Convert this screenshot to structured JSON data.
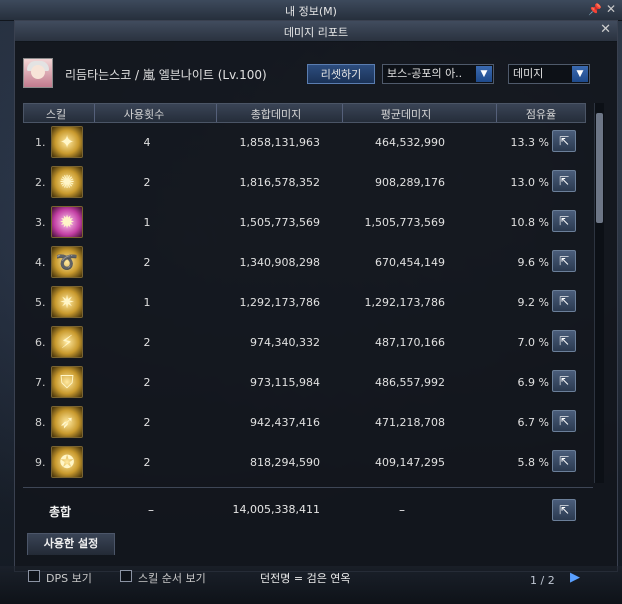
{
  "topbar": {
    "title": "내 정보(M)"
  },
  "window": {
    "title": "데미지 리포트"
  },
  "header": {
    "player": "리듬타는스코 / 嵐 엘븐나이트 (Lv.100)",
    "reset_label": "리셋하기",
    "dungeon_select": "보스-공포의 아..",
    "metric_select": "데미지"
  },
  "table": {
    "columns": [
      "스킬",
      "사용횟수",
      "총합데미지",
      "평균데미지",
      "점유율"
    ],
    "rows": [
      {
        "rank": "1.",
        "icon": "golden-whirl-skill-icon",
        "count": "4",
        "total": "1,858,131,963",
        "avg": "464,532,990",
        "share": "13.3 %"
      },
      {
        "rank": "2.",
        "icon": "golden-spin-skill-icon",
        "count": "2",
        "total": "1,816,578,352",
        "avg": "908,289,176",
        "share": "13.0 %"
      },
      {
        "rank": "3.",
        "icon": "pink-burst-skill-icon",
        "count": "1",
        "total": "1,505,773,569",
        "avg": "1,505,773,569",
        "share": "10.8 %"
      },
      {
        "rank": "4.",
        "icon": "golden-wave-skill-icon",
        "count": "2",
        "total": "1,340,908,298",
        "avg": "670,454,149",
        "share": "9.6 %"
      },
      {
        "rank": "5.",
        "icon": "golden-flame-skill-icon",
        "count": "1",
        "total": "1,292,173,786",
        "avg": "1,292,173,786",
        "share": "9.2 %"
      },
      {
        "rank": "6.",
        "icon": "golden-slash-skill-icon",
        "count": "2",
        "total": "974,340,332",
        "avg": "487,170,166",
        "share": "7.0 %"
      },
      {
        "rank": "7.",
        "icon": "golden-shield-skill-icon",
        "count": "2",
        "total": "973,115,984",
        "avg": "486,557,992",
        "share": "6.9 %"
      },
      {
        "rank": "8.",
        "icon": "golden-spear-skill-icon",
        "count": "2",
        "total": "942,437,416",
        "avg": "471,218,708",
        "share": "6.7 %"
      },
      {
        "rank": "9.",
        "icon": "golden-star-skill-icon",
        "count": "2",
        "total": "818,294,590",
        "avg": "409,147,295",
        "share": "5.8 %"
      }
    ]
  },
  "total": {
    "label": "총합",
    "count": "–",
    "total": "14,005,338,411",
    "avg": "–"
  },
  "tabs": {
    "used_settings": "사용한 설정"
  },
  "footer": {
    "dps_label": "DPS 보기",
    "order_label": "스킬 순서 보기",
    "dungeon_text": "던전명 = 검은 연옥",
    "page": "1 / 2"
  },
  "colors": {
    "accent": "#2d4d7e",
    "icon_gold": "#c99a2e",
    "icon_pink": "#c23fa3"
  }
}
